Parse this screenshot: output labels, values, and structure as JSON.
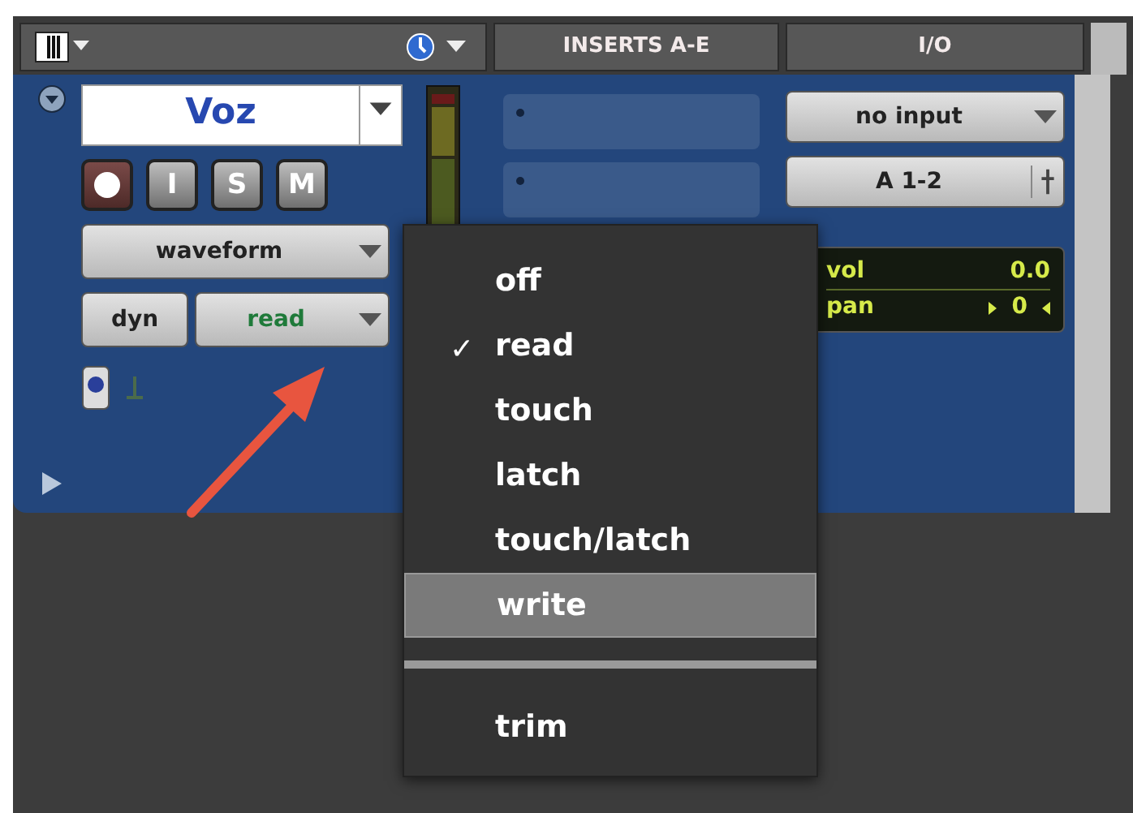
{
  "header": {
    "columns": [
      "INSERTS A-E",
      "I/O"
    ]
  },
  "track": {
    "name": "Voz",
    "buttons": [
      {
        "kind": "record"
      },
      {
        "kind": "toggle",
        "label": "I"
      },
      {
        "kind": "toggle",
        "label": "S"
      },
      {
        "kind": "toggle",
        "label": "M"
      }
    ],
    "view": "waveform",
    "dyn": "dyn",
    "automation": "read"
  },
  "io": {
    "input": "no input",
    "output": "A 1-2",
    "vol_label": "vol",
    "vol_value": "0.0",
    "pan_label": "pan",
    "pan_value": "0"
  },
  "menu": {
    "check_mark": "✓",
    "items": [
      {
        "kind": "item",
        "label": "off",
        "checked": false,
        "selected": false
      },
      {
        "kind": "item",
        "label": "read",
        "checked": true,
        "selected": false
      },
      {
        "kind": "item",
        "label": "touch",
        "checked": false,
        "selected": false
      },
      {
        "kind": "item",
        "label": "latch",
        "checked": false,
        "selected": false
      },
      {
        "kind": "item",
        "label": "touch/latch",
        "checked": false,
        "selected": false
      },
      {
        "kind": "item",
        "label": "write",
        "checked": false,
        "selected": true
      },
      {
        "kind": "separator"
      },
      {
        "kind": "item",
        "label": "trim",
        "checked": false,
        "selected": false
      }
    ]
  }
}
